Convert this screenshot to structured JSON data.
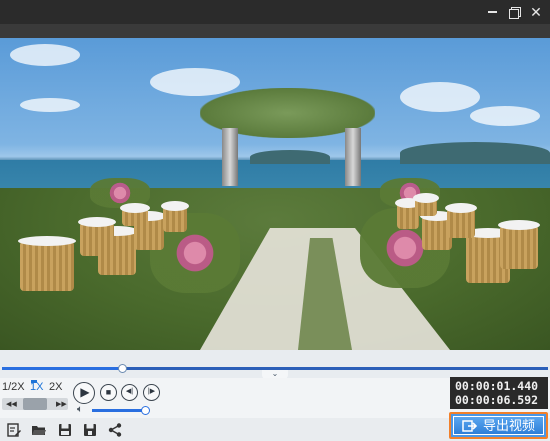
{
  "window": {
    "minimize_icon": "minimize-icon",
    "maximize_icon": "restore-icon",
    "close_label": "✕"
  },
  "playback": {
    "speed_options": [
      "1/2X",
      "1X",
      "2X"
    ],
    "selected_speed": "1X",
    "progress": 0.22,
    "volume": 0.95,
    "time_current": "00:00:01.440",
    "time_total": "00:00:06.592"
  },
  "toolbar": {
    "icons": [
      "edit-icon",
      "open-folder-icon",
      "save-icon",
      "save-as-icon",
      "share-icon"
    ]
  },
  "export": {
    "label": "导出视频"
  },
  "colors": {
    "accent": "#2a6fe0",
    "export_border": "#f2802a",
    "time_bg": "#2a2a2a"
  }
}
